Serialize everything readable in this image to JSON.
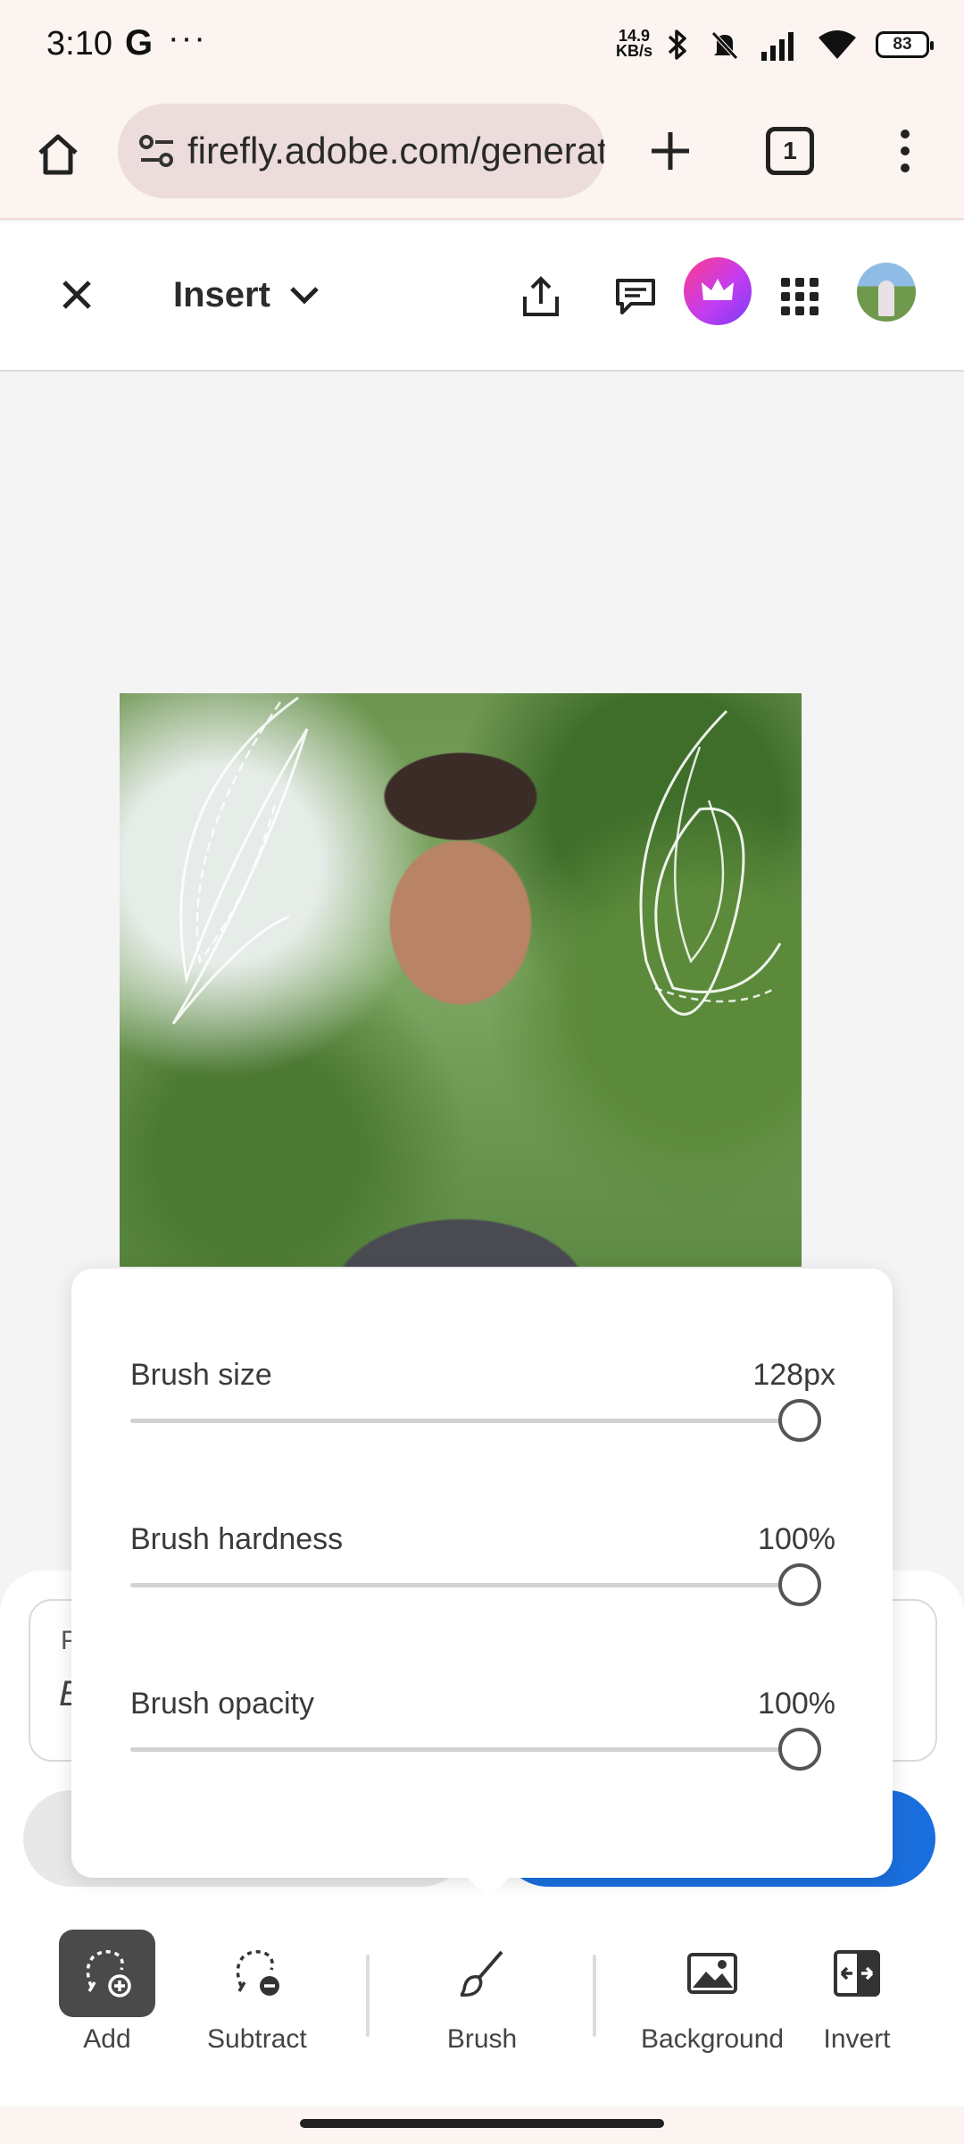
{
  "status_bar": {
    "time": "3:10",
    "google_glyph": "G",
    "more_glyph": "···",
    "net_speed_value": "14.9",
    "net_speed_unit": "KB/s",
    "battery": "83",
    "icons": [
      "bluetooth-icon",
      "mute-icon",
      "signal-icon",
      "wifi-icon",
      "battery-icon"
    ]
  },
  "browser": {
    "url": "firefly.adobe.com/generate",
    "tab_count": "1",
    "icons": [
      "home-icon",
      "site-settings-icon",
      "plus-icon",
      "tabs-icon",
      "more-vert-icon"
    ]
  },
  "header": {
    "mode_label": "Insert",
    "icons": [
      "close-icon",
      "chevron-down-icon",
      "share-icon",
      "comment-icon",
      "crown-icon",
      "apps-grid-icon",
      "avatar"
    ]
  },
  "prompt": {
    "label_visible": "P",
    "value_visible": "E"
  },
  "brush_settings": {
    "size_label": "Brush size",
    "size_value": "128px",
    "size_fraction": 1.0,
    "hardness_label": "Brush hardness",
    "hardness_value": "100%",
    "hardness_fraction": 1.0,
    "opacity_label": "Brush opacity",
    "opacity_value": "100%",
    "opacity_fraction": 1.0
  },
  "toolbar": {
    "add_label": "Add",
    "subtract_label": "Subtract",
    "brush_label": "Brush",
    "background_label": "Background",
    "invert_label": "Invert",
    "active_tool": "Add"
  },
  "colors": {
    "accent_blue": "#1a6fde",
    "premium_pink": "#ff3c8c",
    "premium_purple": "#7a3cf5",
    "active_tool_bg": "#4a4a4a",
    "chrome_bg": "#fbf4f0"
  }
}
